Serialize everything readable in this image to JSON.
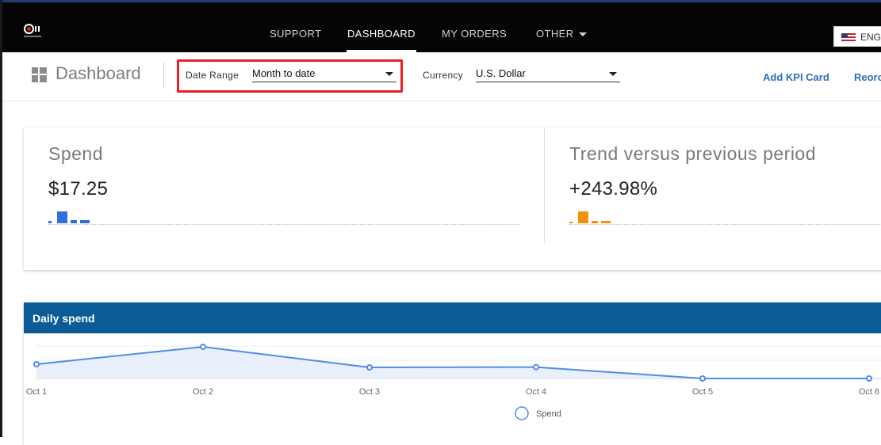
{
  "nav": {
    "items": [
      {
        "label": "SUPPORT",
        "active": false
      },
      {
        "label": "DASHBOARD",
        "active": true
      },
      {
        "label": "MY ORDERS",
        "active": false
      },
      {
        "label": "OTHER",
        "active": false
      }
    ],
    "language": "ENG",
    "flag_icon": "us-flag-icon"
  },
  "toolbar": {
    "title": "Dashboard",
    "title_icon": "grid-icon",
    "date_range": {
      "label": "Date Range",
      "value": "Month to date"
    },
    "currency": {
      "label": "Currency",
      "value": "U.S. Dollar"
    },
    "add_kpi_label": "Add KPI Card",
    "reorder_label": "Reorc",
    "link_color": "#2d6db5",
    "highlight_color": "#ee1c25"
  },
  "kpis": [
    {
      "title": "Spend",
      "value": "$17.25",
      "color": "#2f6fdc",
      "spark": [
        0.2,
        1.0,
        0.25,
        0.25
      ]
    },
    {
      "title": "Trend versus previous period",
      "value": "+243.98%",
      "color": "#f4900c",
      "spark": [
        0.1,
        1.0,
        0.2,
        0.2
      ]
    }
  ],
  "daily_spend": {
    "title": "Daily spend",
    "header_color": "#0b5c96",
    "legend": "Spend"
  },
  "chart_data": {
    "type": "area",
    "title": "Daily spend",
    "xlabel": "",
    "ylabel": "",
    "categories": [
      "Oct 1",
      "Oct 2",
      "Oct 3",
      "Oct 4",
      "Oct 5",
      "Oct 6"
    ],
    "series": [
      {
        "name": "Spend",
        "values": [
          0.45,
          1.0,
          0.35,
          0.36,
          0.0,
          0.0
        ],
        "color": "#4f8be8"
      }
    ],
    "ylim": [
      0,
      1.1
    ],
    "grid": true,
    "legend_position": "bottom"
  }
}
